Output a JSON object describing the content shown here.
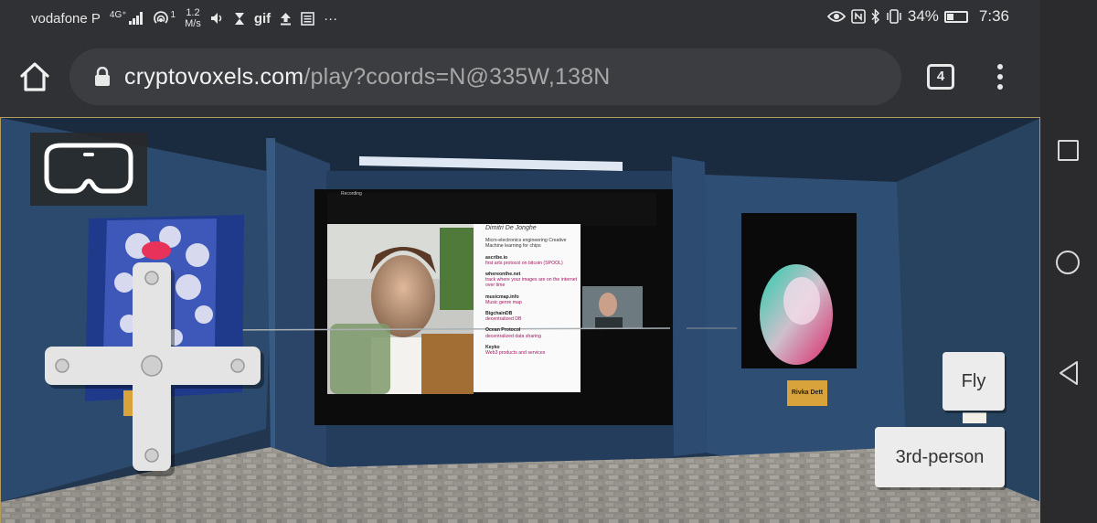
{
  "status_bar": {
    "carrier": "vodafone P",
    "signal_label": "4G⁺",
    "hotspot_count": "1",
    "net_speed_value": "1.2",
    "net_speed_unit": "M/s",
    "gif_label": "gif",
    "more_label": "···",
    "battery_percent": "34%",
    "battery_level": 0.34,
    "time": "7:36"
  },
  "browser": {
    "url_host": "cryptovoxels.com",
    "url_path": "/play?coords=N@335W,138N",
    "tab_count": "4"
  },
  "scene": {
    "recording_label": "Recording",
    "slide": {
      "name": "Dimitri De Jonghe",
      "intro": "Micro-electronics engineering Creative Machine learning for chips",
      "items": [
        {
          "title": "ascribe.io",
          "desc": "first arts protocol on bitcoin (SPOOL)"
        },
        {
          "title": "whereonthe.net",
          "desc": "track where your images are on the internet over time"
        },
        {
          "title": "musicmap.info",
          "desc": "Music genre map"
        },
        {
          "title": "BigchainDB",
          "desc": "decentralized DB"
        },
        {
          "title": "Ocean Protocol",
          "desc": "decentralized data sharing"
        },
        {
          "title": "Keyko",
          "desc": "Web3 products and services"
        }
      ]
    },
    "poster_label": "Rivka Dett"
  },
  "controls": {
    "fly_label": "Fly",
    "third_person_label": "3rd-person"
  },
  "icons": {
    "home": "home-icon",
    "lock": "lock-icon",
    "tabs": "tab-switcher-icon",
    "menu": "overflow-menu-icon",
    "vr": "vr-headset-icon",
    "dpad": "dpad-icon"
  },
  "colors": {
    "chrome_bg": "#303134",
    "url_box": "#3c3d40",
    "scene_wall": "#2c4a6e",
    "slide_accent": "#a0155e",
    "button_bg": "#ececec"
  }
}
